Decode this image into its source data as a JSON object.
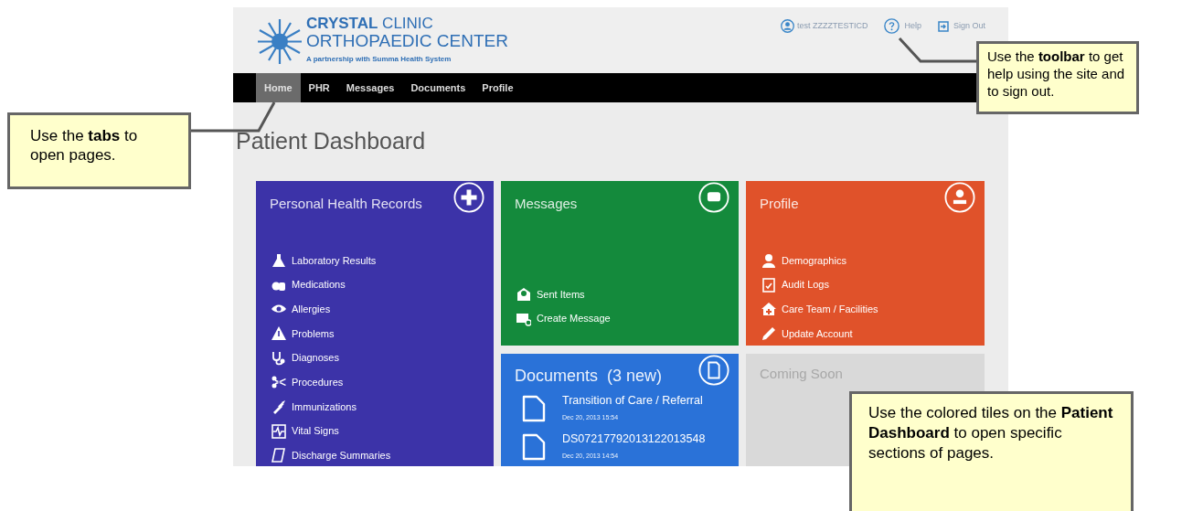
{
  "header": {
    "logo_title": "**CRYSTAL** CLINIC",
    "logo_subtitle": "ORTHOPAEDIC CENTER",
    "logo_tagline": "A partnership with Summa Health System",
    "user": "test ZZZZTESTICD",
    "help": "Help",
    "sign_out": "Sign Out"
  },
  "tabs": [
    {
      "label": "Home",
      "selected": true
    },
    {
      "label": "PHR",
      "selected": false
    },
    {
      "label": "Messages",
      "selected": false
    },
    {
      "label": "Documents",
      "selected": false
    },
    {
      "label": "Profile",
      "selected": false
    }
  ],
  "page_title": "Patient Dashboard",
  "tiles": [
    {
      "kind": "menu",
      "title": "Personal Health Records",
      "color": "#3c33a8",
      "items": [
        "Laboratory Results",
        "Medications",
        "Allergies",
        "Problems",
        "Diagnoses",
        "Procedures",
        "Immunizations",
        "Vital Signs",
        "Discharge Summaries"
      ]
    },
    {
      "kind": "actions",
      "title": "Messages",
      "color": "#148a3c",
      "items": [
        "Sent Items",
        "Create Message"
      ]
    },
    {
      "kind": "menu",
      "title": "Profile",
      "color": "#e0522a",
      "items": [
        "Demographics",
        "Audit Logs",
        "Care Team / Facilities",
        "Update Account"
      ]
    },
    {
      "kind": "documents",
      "title": "Documents  (3 new)",
      "color": "#2a72d8",
      "documents": [
        {
          "title": "Transition of Care / Referral",
          "date": "Dec 20, 2013 15:54"
        },
        {
          "title": "DS07217792013122013548",
          "date": "Dec 20, 2013 14:54"
        }
      ]
    },
    {
      "kind": "placeholder",
      "title": "Coming Soon",
      "color": "#d9d9d9"
    }
  ],
  "callouts": [
    {
      "text": "Use the **tabs** to open pages."
    },
    {
      "text": "Use the **toolbar** to get help using the site and to sign out."
    },
    {
      "text": "Use the colored tiles on the **Patient Dashboard** to open specific sections of pages."
    }
  ]
}
